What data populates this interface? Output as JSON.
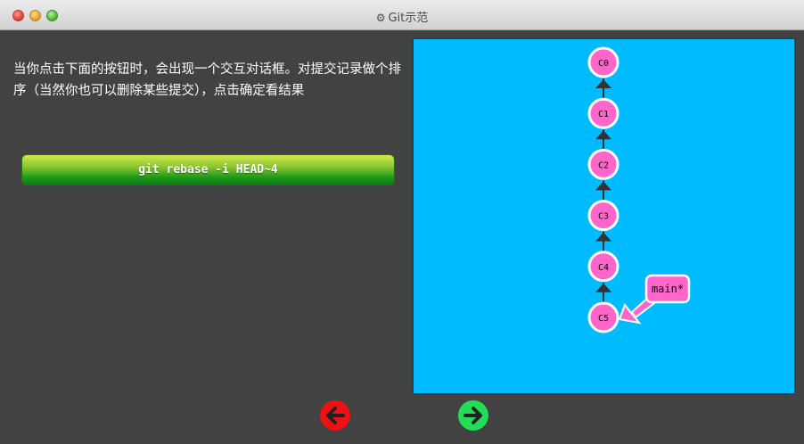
{
  "window": {
    "title": "Git示范",
    "icon": "gear-icon"
  },
  "description": {
    "text": "当你点击下面的按钮时，会出现一个交互对话框。对提交记录做个排序（当然你也可以删除某些提交），点击确定看结果"
  },
  "command_button": {
    "label": "git rebase -i HEAD~4"
  },
  "commit_graph": {
    "background_color": "#00bbff",
    "commit_color": "#ff66cc",
    "branch_color": "#ff66cc",
    "commits": [
      {
        "id": "C0"
      },
      {
        "id": "C1"
      },
      {
        "id": "C2"
      },
      {
        "id": "C3"
      },
      {
        "id": "C4"
      },
      {
        "id": "C5"
      }
    ],
    "branch": {
      "label": "main*",
      "target": "C5"
    }
  },
  "navigation": {
    "prev_icon": "arrow-left-icon",
    "prev_color": "#ee1111",
    "next_icon": "arrow-right-icon",
    "next_color": "#22dd55"
  }
}
